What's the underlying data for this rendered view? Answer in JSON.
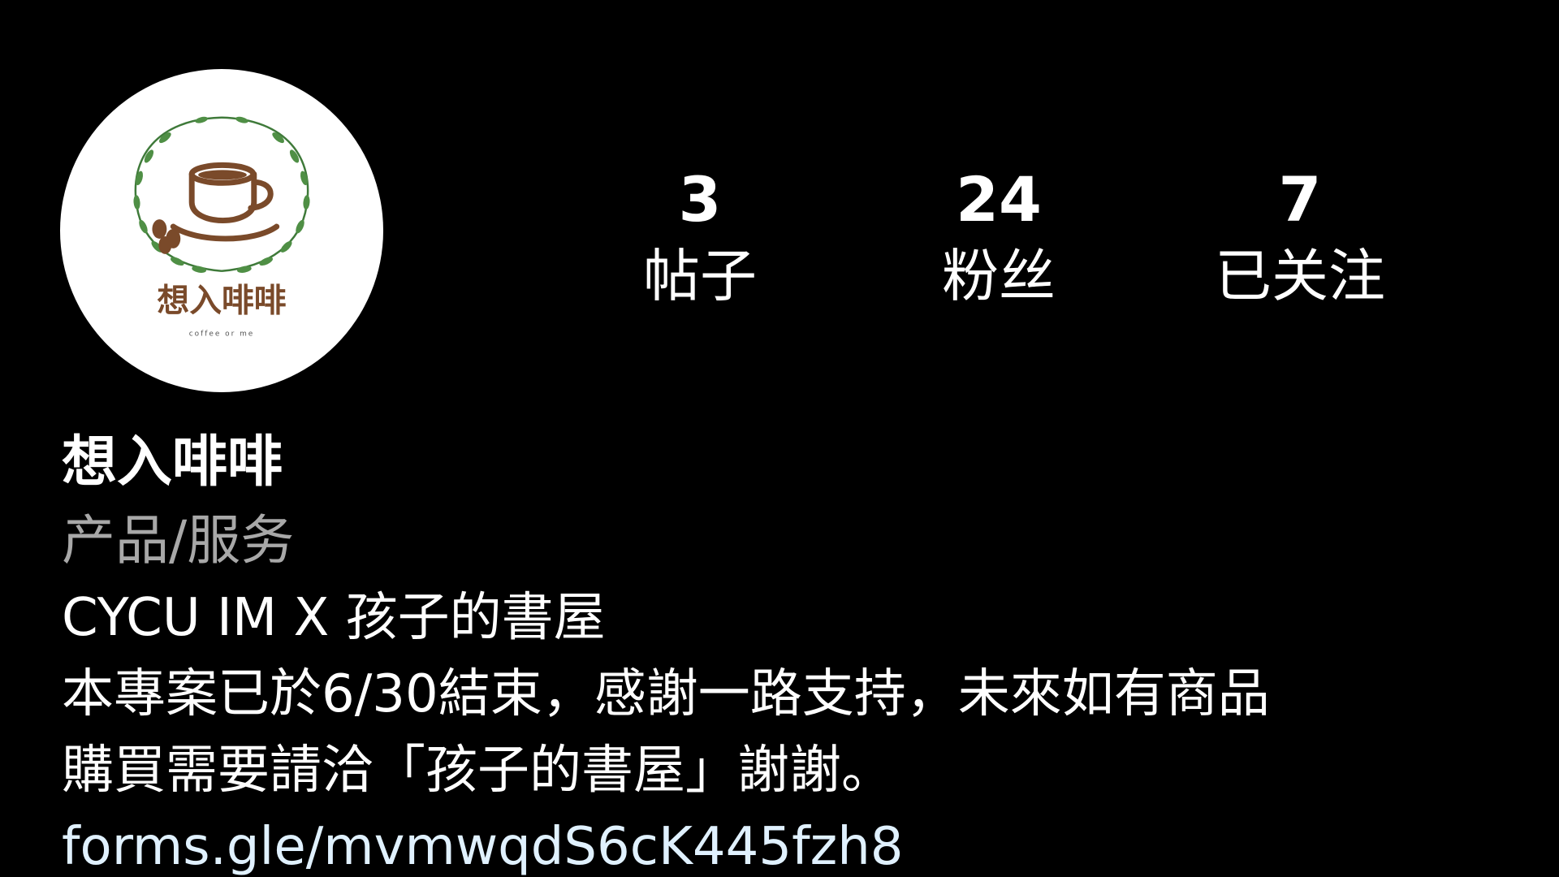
{
  "profile": {
    "avatar": {
      "logo_text": "想入啡啡",
      "logo_subtext": "coffee or me",
      "icon": "coffee-cup-icon"
    },
    "stats": {
      "posts_count": "3",
      "posts_label": "帖子",
      "followers_count": "24",
      "followers_label": "粉丝",
      "following_count": "7",
      "following_label": "已关注"
    },
    "display_name": "想入啡啡",
    "category": "产品/服务",
    "bio_lines": [
      "CYCU IM X 孩子的書屋",
      "本專案已於6/30結束，感謝一路支持，未來如有商品",
      "購買需要請洽「孩子的書屋」謝謝。"
    ],
    "link": "forms.gle/mvmwqdS6cK445fzh8"
  },
  "colors": {
    "background": "#000000",
    "text_primary": "#ffffff",
    "text_secondary": "#a8a8a8",
    "link": "#e0f1ff",
    "logo_brown": "#7a4a2a",
    "logo_green": "#3f7a3a"
  }
}
